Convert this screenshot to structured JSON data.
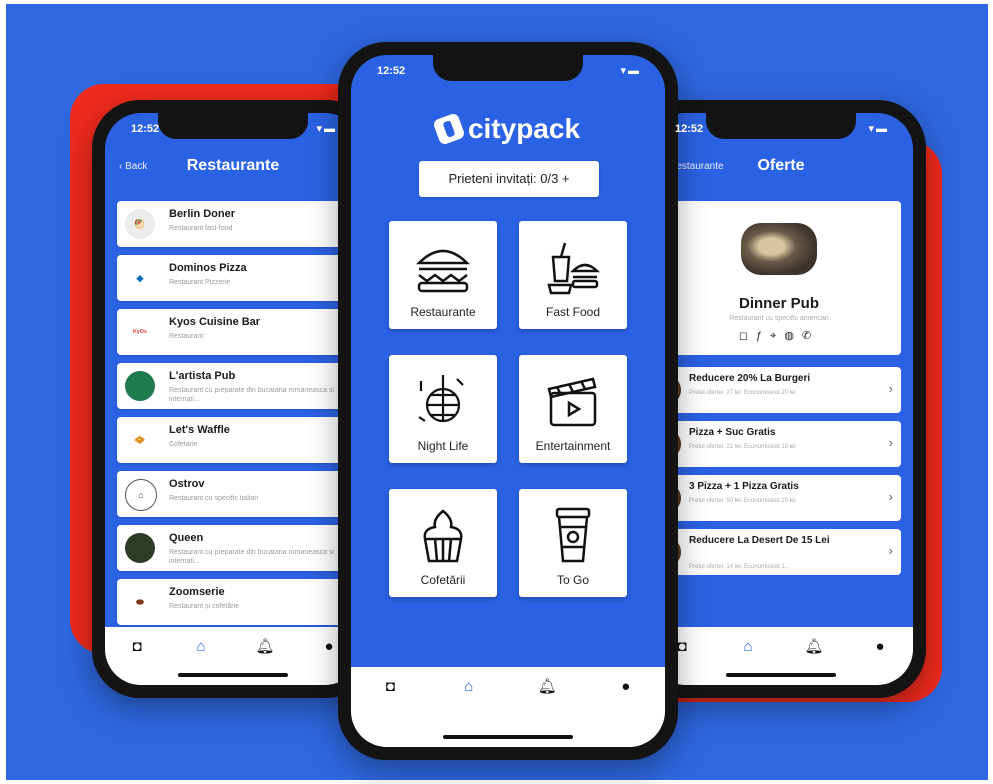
{
  "left_screen": {
    "status_time": "12:52",
    "back_label": "Back",
    "title": "Restaurante",
    "items": [
      {
        "name": "Berlin Doner",
        "subtitle": "Restaurant fast-food"
      },
      {
        "name": "Dominos Pizza",
        "subtitle": "Restaurant Pizzerie"
      },
      {
        "name": "Kyos Cuisine Bar",
        "subtitle": "Restaurant"
      },
      {
        "name": "L'artista Pub",
        "subtitle": "Restaurant cu preparate din bucataria romaneasca si internati..."
      },
      {
        "name": "Let's Waffle",
        "subtitle": "Cofetarie"
      },
      {
        "name": "Ostrov",
        "subtitle": "Restaurant cu specific italian"
      },
      {
        "name": "Queen",
        "subtitle": "Restaurant cu preparate din bucataria romaneasca si internati..."
      },
      {
        "name": "Zoomserie",
        "subtitle": "Restaurant și cofetărie"
      }
    ]
  },
  "center_screen": {
    "status_time": "12:52",
    "brand": "citypack",
    "invite_label": "Prieteni invitați: 0/3 +",
    "tiles": [
      {
        "label": "Restaurante",
        "icon": "burger-icon"
      },
      {
        "label": "Fast Food",
        "icon": "fast-food-icon"
      },
      {
        "label": "Night Life",
        "icon": "disco-ball-icon"
      },
      {
        "label": "Entertainment",
        "icon": "clapperboard-icon"
      },
      {
        "label": "Cofetării",
        "icon": "cupcake-icon"
      },
      {
        "label": "To Go",
        "icon": "coffee-cup-icon"
      }
    ]
  },
  "right_screen": {
    "status_time": "12:52",
    "back_label": "Restaurante",
    "title": "Oferte",
    "pub_name": "Dinner Pub",
    "pub_subtitle": "Restaurant cu specific american",
    "offers": [
      {
        "title": "Reducere 20% La Burgeri",
        "subtitle": "Pretul ofertei: 27 lei. Economisesti 20 lei"
      },
      {
        "title": "Pizza + Suc Gratis",
        "subtitle": "Pretul ofertei: 21 lei. Economisesti 10 lei"
      },
      {
        "title": "3 Pizza + 1 Pizza Gratis",
        "subtitle": "Pretul ofertei: 50 lei. Economisesti 20 lei"
      },
      {
        "title": "Reducere La Desert De 15 Lei",
        "subtitle": "Pretul ofertei: 14 lei. Economisesti 1..."
      }
    ]
  },
  "colors": {
    "brand_blue": "#2b62e3",
    "accent_red": "#ef2b1d"
  }
}
